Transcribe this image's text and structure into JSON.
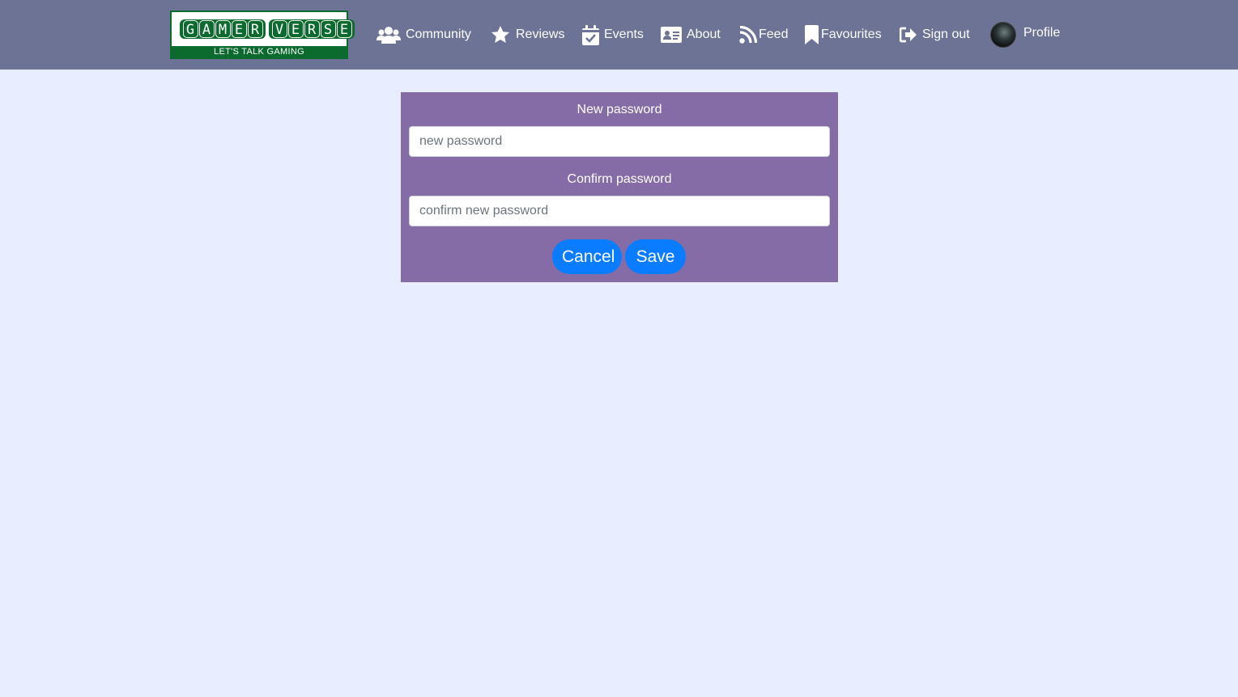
{
  "logo": {
    "words": [
      [
        "G",
        "A",
        "M",
        "E",
        "R"
      ],
      [
        "V",
        "E",
        "R",
        "S",
        "E"
      ]
    ],
    "tagline": "LET'S TALK GAMING"
  },
  "nav": {
    "items": [
      {
        "label": "Community",
        "icon": "users-icon"
      },
      {
        "label": "Reviews",
        "icon": "star-icon"
      },
      {
        "label": "Events",
        "icon": "calendar-check-icon"
      },
      {
        "label": "About",
        "icon": "id-card-icon"
      },
      {
        "label": "Feed",
        "icon": "rss-icon"
      },
      {
        "label": "Favourites",
        "icon": "bookmark-icon"
      },
      {
        "label": "Sign out",
        "icon": "sign-out-icon"
      },
      {
        "label": "Profile",
        "icon": "avatar"
      }
    ]
  },
  "form": {
    "new_password_label": "New password",
    "new_password_placeholder": "new password",
    "new_password_value": "",
    "confirm_password_label": "Confirm password",
    "confirm_password_placeholder": "confirm new password",
    "confirm_password_value": "",
    "cancel_label": "Cancel",
    "save_label": "Save"
  },
  "colors": {
    "navbar": "#6c7394",
    "page_background": "#e8eeff",
    "form_background": "#866ca6",
    "button": "#0a7cff",
    "logo_green": "#0b6b2e"
  }
}
